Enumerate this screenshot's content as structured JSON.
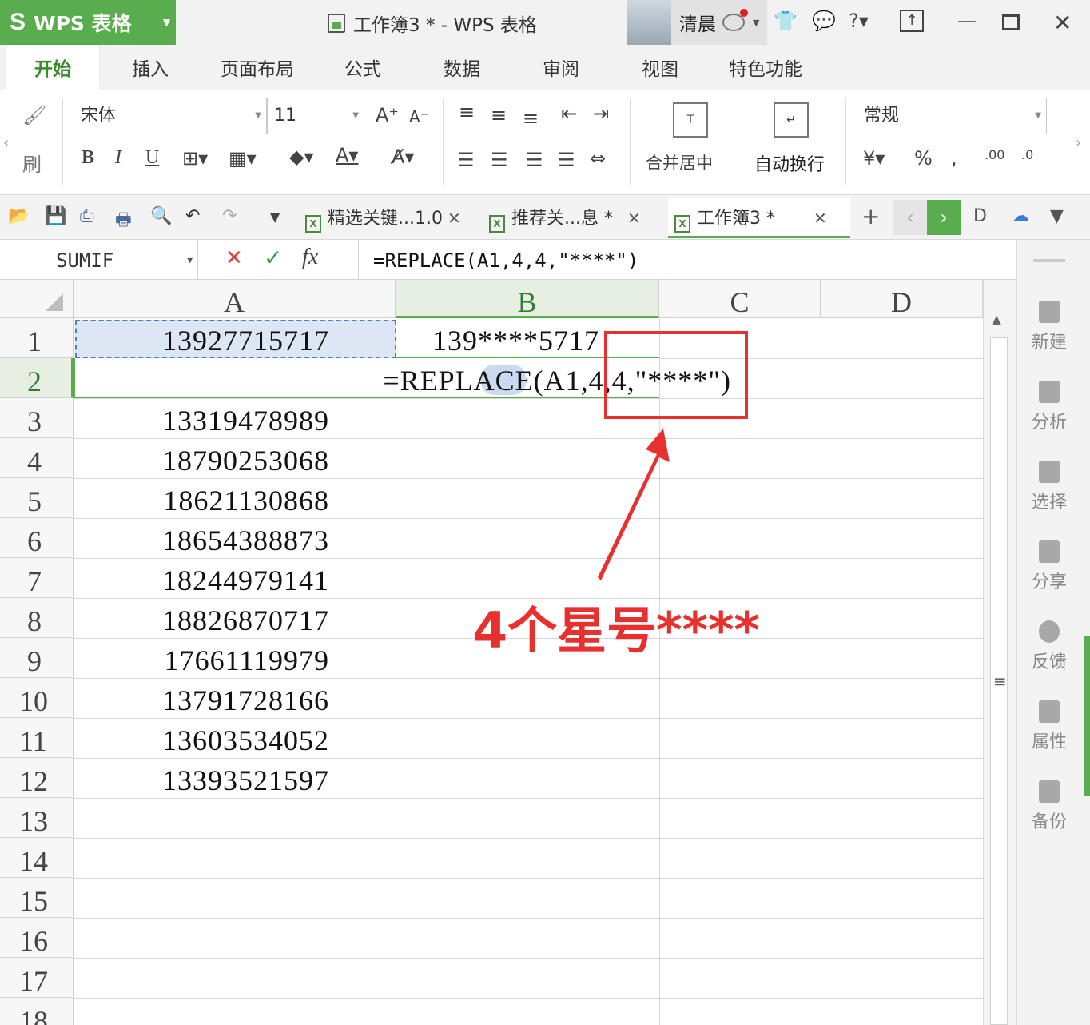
{
  "app": {
    "brand": "WPS 表格",
    "logo_letter": "S"
  },
  "window": {
    "title": "工作簿3 * - WPS 表格",
    "user_name": "清晨"
  },
  "ribbon_tabs": [
    "开始",
    "插入",
    "页面布局",
    "公式",
    "数据",
    "审阅",
    "视图",
    "特色功能"
  ],
  "ribbon": {
    "format_painter": "刷",
    "font_name": "宋体",
    "font_size": "11",
    "bold": "B",
    "italic": "I",
    "underline": "U",
    "merge_center": "合并居中",
    "wrap_text": "自动换行",
    "number_format": "常规",
    "percent": "%"
  },
  "doc_tabs": [
    {
      "label": "精选关键...1.0",
      "active": false
    },
    {
      "label": "推荐关...息 *",
      "active": false
    },
    {
      "label": "工作簿3 *",
      "active": true
    }
  ],
  "formula_bar": {
    "name_box": "SUMIF",
    "cancel": "✕",
    "confirm": "✓",
    "fx": "fx",
    "formula": "=REPLACE(A1,4,4,\"****\")"
  },
  "grid": {
    "columns": [
      "A",
      "B",
      "C",
      "D"
    ],
    "rows": [
      "1",
      "2",
      "3",
      "4",
      "5",
      "6",
      "7",
      "8",
      "9",
      "10",
      "11",
      "12",
      "13",
      "14",
      "15",
      "16",
      "17",
      "18"
    ],
    "colA": [
      "13927715717",
      "",
      "13319478989",
      "18790253068",
      "18621130868",
      "18654388873",
      "18244979141",
      "18826870717",
      "17661119979",
      "13791728166",
      "13603534052",
      "13393521597"
    ],
    "b1": "139****5717",
    "editing_formula": "=REPLACE(A1,4,4,\"****\")"
  },
  "sidebar": [
    "新建",
    "分析",
    "选择",
    "分享",
    "反馈",
    "属性",
    "备份"
  ],
  "annotation": {
    "text": "4个星号****",
    "color": "#e8302e"
  },
  "colors": {
    "brand_green": "#5aad4e",
    "annotation_red": "#e8302e"
  }
}
